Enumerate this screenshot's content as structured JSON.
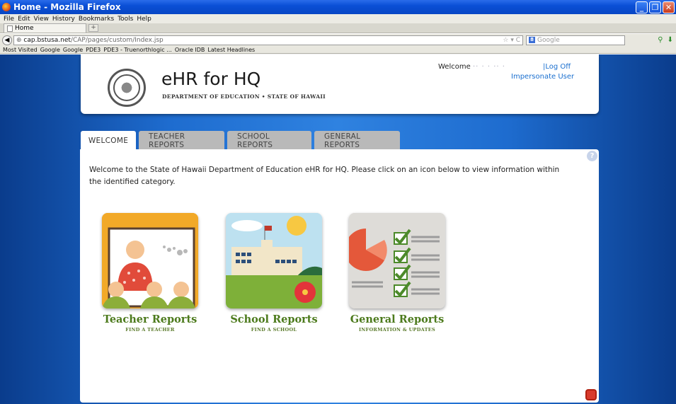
{
  "window": {
    "title": "Home - Mozilla Firefox"
  },
  "menu": [
    "File",
    "Edit",
    "View",
    "History",
    "Bookmarks",
    "Tools",
    "Help"
  ],
  "browser_tab": {
    "label": "Home"
  },
  "url": {
    "host": "cap.bstusa.net",
    "path": "/CAP/pages/custom/Index.jsp",
    "search_placeholder": "Google"
  },
  "bookmarks": [
    "Most Visited",
    "Google",
    "Google",
    "PDE3",
    "PDE3 - Truenorthlogic ...",
    "Oracle IDB",
    "Latest Headlines"
  ],
  "header": {
    "brand": "eHR for HQ",
    "subtitle": "DEPARTMENT OF EDUCATION • STATE OF HAWAII",
    "welcome": "Welcome",
    "user_name": "·· ·  ·  ·· ·",
    "logoff": "|Log Off",
    "impersonate": "Impersonate User"
  },
  "tabs": [
    "WELCOME",
    "TEACHER REPORTS",
    "SCHOOL REPORTS",
    "GENERAL REPORTS"
  ],
  "intro": "Welcome to the State of Hawaii Department of Education eHR for HQ. Please click on an icon below to view information within the identified category.",
  "tiles": [
    {
      "title": "Teacher Reports",
      "subtitle": "FIND A TEACHER"
    },
    {
      "title": "School Reports",
      "subtitle": "FIND A SCHOOL"
    },
    {
      "title": "General Reports",
      "subtitle": "INFORMATION & UPDATES"
    }
  ]
}
